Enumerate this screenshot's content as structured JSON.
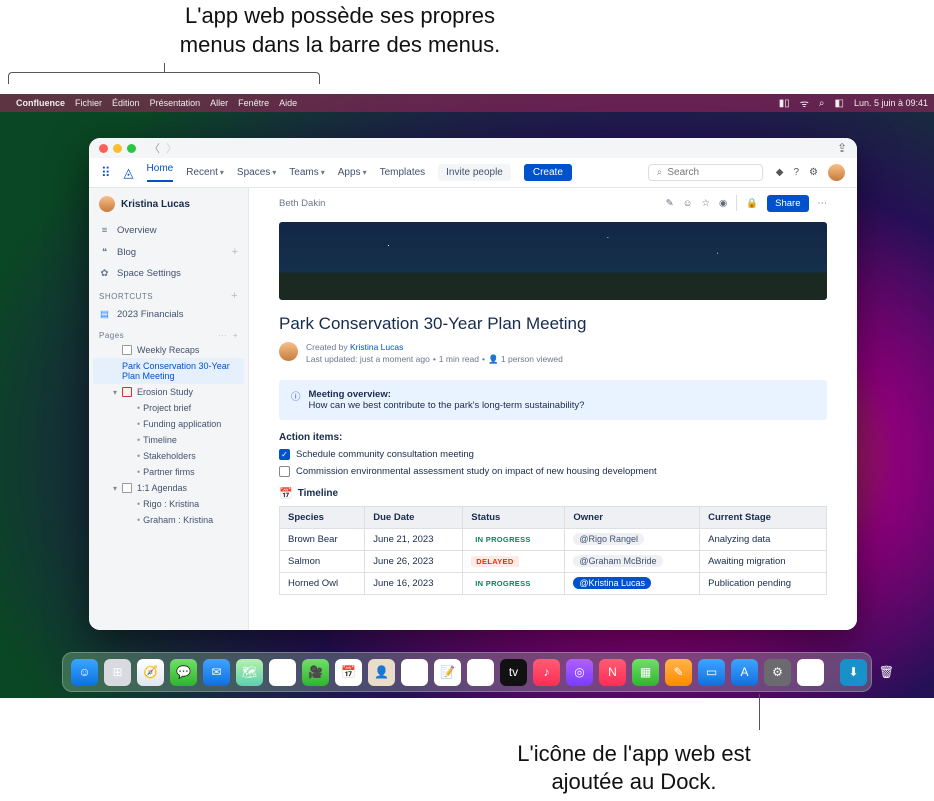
{
  "annotations": {
    "top1": "L'app web possède ses propres",
    "top2": "menus dans la barre des menus.",
    "bottom1": "L'icône de l'app web est",
    "bottom2": "ajoutée au Dock."
  },
  "menubar": {
    "app": "Confluence",
    "items": [
      "Fichier",
      "Édition",
      "Présentation",
      "Aller",
      "Fenêtre",
      "Aide"
    ],
    "clock": "Lun. 5 juin à 09:41"
  },
  "window": {
    "nav": {
      "home": "Home",
      "recent": "Recent",
      "spaces": "Spaces",
      "teams": "Teams",
      "apps": "Apps",
      "templates": "Templates",
      "invite": "Invite people",
      "create": "Create",
      "searchPlaceholder": "Search"
    },
    "sidebar": {
      "user": "Kristina Lucas",
      "items": [
        {
          "icon": "≡",
          "label": "Overview"
        },
        {
          "icon": "❝",
          "label": "Blog"
        },
        {
          "icon": "✿",
          "label": "Space Settings"
        }
      ],
      "shortcutsTitle": "SHORTCUTS",
      "shortcuts": [
        {
          "label": "2023 Financials"
        }
      ],
      "pagesTitle": "Pages",
      "pages": [
        {
          "label": "Weekly Recaps",
          "level": 1,
          "icon": "doc"
        },
        {
          "label": "Park Conservation 30-Year Plan Meeting",
          "level": 1,
          "selected": true
        },
        {
          "label": "Erosion Study",
          "level": 1,
          "caret": "▾",
          "icon": "red"
        },
        {
          "label": "Project brief",
          "level": 3
        },
        {
          "label": "Funding application",
          "level": 3
        },
        {
          "label": "Timeline",
          "level": 3
        },
        {
          "label": "Stakeholders",
          "level": 3
        },
        {
          "label": "Partner firms",
          "level": 3
        },
        {
          "label": "1:1 Agendas",
          "level": 1,
          "caret": "▾",
          "icon": "doc"
        },
        {
          "label": "Rigo : Kristina",
          "level": 3
        },
        {
          "label": "Graham : Kristina",
          "level": 3
        }
      ]
    },
    "page": {
      "breadcrumb": "Beth Dakin",
      "share": "Share",
      "title": "Park Conservation 30-Year Plan Meeting",
      "createdBy": "Created by ",
      "author": "Kristina Lucas",
      "updated": "Last updated: just a moment ago",
      "readTime": "1 min read",
      "views": "1 person viewed",
      "panelTitle": "Meeting overview:",
      "panelBody": "How can we best contribute to the park's long-term sustainability?",
      "actionTitle": "Action items:",
      "actions": [
        {
          "checked": true,
          "text": "Schedule community consultation meeting"
        },
        {
          "checked": false,
          "text": "Commission environmental assessment study on impact of new housing development"
        }
      ],
      "timelineTitle": "Timeline",
      "table": {
        "headers": [
          "Species",
          "Due Date",
          "Status",
          "Owner",
          "Current Stage"
        ],
        "rows": [
          {
            "species": "Brown Bear",
            "due": "June 21, 2023",
            "status": "IN PROGRESS",
            "statusClass": "loz-inprog",
            "owner": "@Rigo Rangel",
            "ownerSel": false,
            "stage": "Analyzing data"
          },
          {
            "species": "Salmon",
            "due": "June 26, 2023",
            "status": "DELAYED",
            "statusClass": "loz-delayed",
            "owner": "@Graham McBride",
            "ownerSel": false,
            "stage": "Awaiting migration"
          },
          {
            "species": "Horned Owl",
            "due": "June 16, 2023",
            "status": "IN PROGRESS",
            "statusClass": "loz-inprog",
            "owner": "@Kristina Lucas",
            "ownerSel": true,
            "stage": "Publication pending"
          }
        ]
      }
    }
  },
  "dock": [
    {
      "name": "finder",
      "bg": "linear-gradient(#37a7ff,#0f6fe0)",
      "glyph": "☺"
    },
    {
      "name": "launchpad",
      "bg": "#d9d9e0",
      "glyph": "⊞"
    },
    {
      "name": "safari",
      "bg": "linear-gradient(#fff,#dfe6ef)",
      "glyph": "🧭"
    },
    {
      "name": "messages",
      "bg": "linear-gradient(#6fe06a,#2fb52b)",
      "glyph": "💬"
    },
    {
      "name": "mail",
      "bg": "linear-gradient(#3fa4ff,#0f6fe0)",
      "glyph": "✉"
    },
    {
      "name": "maps",
      "bg": "linear-gradient(#b6f2a8,#5ecfb0)",
      "glyph": "🗺"
    },
    {
      "name": "photos",
      "bg": "#fff",
      "glyph": "✿"
    },
    {
      "name": "facetime",
      "bg": "linear-gradient(#6fe06a,#2fb52b)",
      "glyph": "🎥"
    },
    {
      "name": "calendar",
      "bg": "#fff",
      "glyph": "📅"
    },
    {
      "name": "contacts",
      "bg": "#e9dcc8",
      "glyph": "👤"
    },
    {
      "name": "reminders",
      "bg": "#fff",
      "glyph": "☰"
    },
    {
      "name": "notes",
      "bg": "#fff",
      "glyph": "📝"
    },
    {
      "name": "freeform",
      "bg": "#fff",
      "glyph": "✎"
    },
    {
      "name": "tv",
      "bg": "#111",
      "glyph": "tv"
    },
    {
      "name": "music",
      "bg": "linear-gradient(#ff5c74,#ff2d55)",
      "glyph": "♪"
    },
    {
      "name": "podcasts",
      "bg": "linear-gradient(#b060ff,#7a3cff)",
      "glyph": "◎"
    },
    {
      "name": "news",
      "bg": "linear-gradient(#ff5c74,#ff2d55)",
      "glyph": "N"
    },
    {
      "name": "numbers",
      "bg": "linear-gradient(#6fe06a,#2fb52b)",
      "glyph": "▦"
    },
    {
      "name": "pages",
      "bg": "linear-gradient(#ffb44a,#ff8a00)",
      "glyph": "✎"
    },
    {
      "name": "keynote",
      "bg": "linear-gradient(#3fa4ff,#0f6fe0)",
      "glyph": "▭"
    },
    {
      "name": "appstore",
      "bg": "linear-gradient(#3fa4ff,#0f6fe0)",
      "glyph": "A"
    },
    {
      "name": "settings",
      "bg": "#6a6a6f",
      "glyph": "⚙"
    },
    {
      "name": "confluence",
      "bg": "#fff",
      "glyph": "◬"
    },
    {
      "name": "sep"
    },
    {
      "name": "downloads",
      "bg": "#1890c9",
      "glyph": "⬇"
    },
    {
      "name": "trash",
      "bg": "transparent",
      "glyph": "🗑"
    }
  ]
}
